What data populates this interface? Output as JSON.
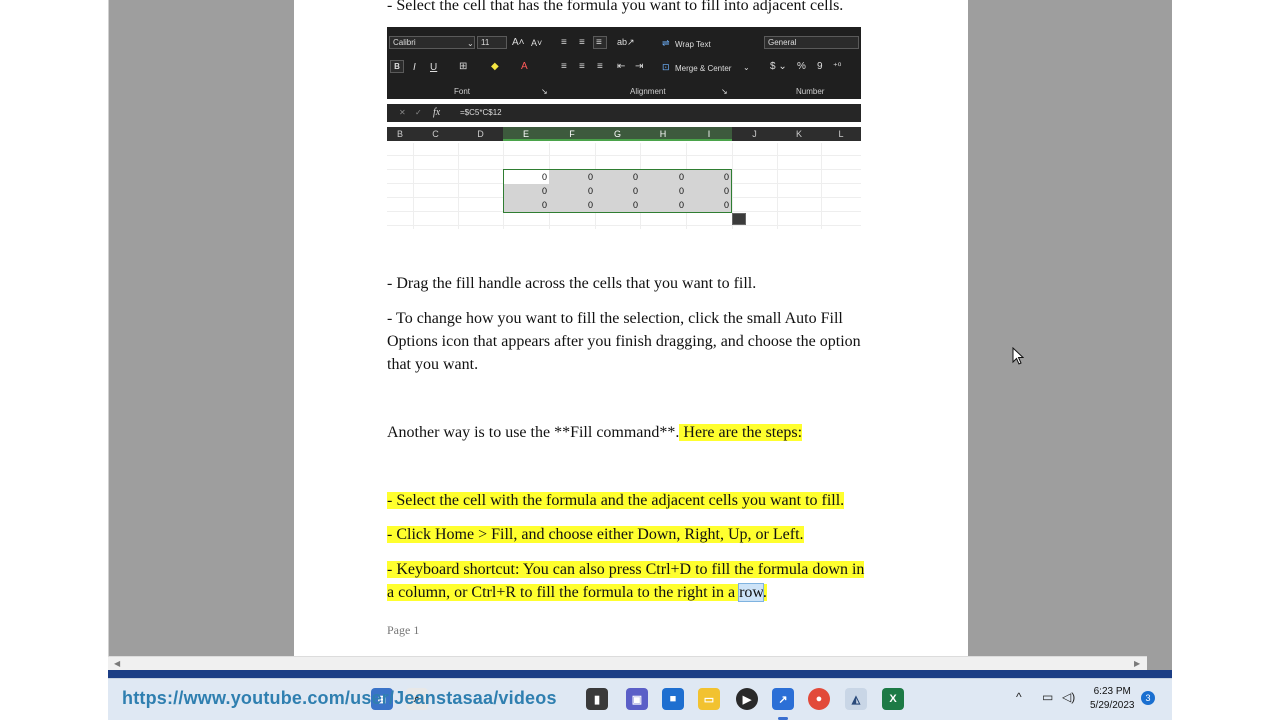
{
  "document": {
    "top_line": "- Select the cell that has the formula you want to fill into adjacent cells.",
    "drag_line": "- Drag the fill handle across the cells that you want to fill.",
    "change_line_1": "- To change how you want to fill the selection, click the small Auto Fill",
    "change_line_2": "Options icon that appears after you finish dragging, and choose the option",
    "change_line_3": "that you want.",
    "another_way": "Another way is to use the **Fill command**.",
    "steps_intro": " Here are the steps:",
    "step_select": "- Select the cell with the formula and the adjacent cells you want to fill.",
    "step_home": "- Click Home > Fill, and choose either Down, Right, Up, or Left.",
    "step_keyboard_1": "- Keyboard shortcut: You can also press Ctrl+D to fill the formula down in",
    "step_keyboard_2a": "a column, or Ctrl+R to fill the formula to the right in a ",
    "step_keyboard_2b": "row",
    "step_keyboard_2c": ".",
    "page_number": "Page 1"
  },
  "excel": {
    "font_name": "Calibri",
    "font_size": "11",
    "wrap_text": "Wrap Text",
    "merge_center": "Merge & Center",
    "number_format": "General",
    "group_font": "Font",
    "group_alignment": "Alignment",
    "group_number": "Number",
    "bold": "B",
    "italic": "I",
    "underline": "U",
    "fx": "fx",
    "formula": "=$C5*C$12",
    "columns": [
      "B",
      "C",
      "D",
      "E",
      "F",
      "G",
      "H",
      "I",
      "J",
      "K",
      "L"
    ],
    "rows": [
      [
        "0",
        "0",
        "0",
        "0",
        "0"
      ],
      [
        "0",
        "0",
        "0",
        "0",
        "0"
      ],
      [
        "0",
        "0",
        "0",
        "0",
        "0"
      ]
    ]
  },
  "taskbar": {
    "url_overlay": "https://www.youtube.com/user/Jeanstasaa/videos",
    "time": "6:23 PM",
    "date": "5/29/2023",
    "notification_count": "3"
  },
  "colors": {
    "highlight": "#ffff2e",
    "excel_accent": "#2f7d32",
    "taskbar": "#dfe8f3"
  }
}
